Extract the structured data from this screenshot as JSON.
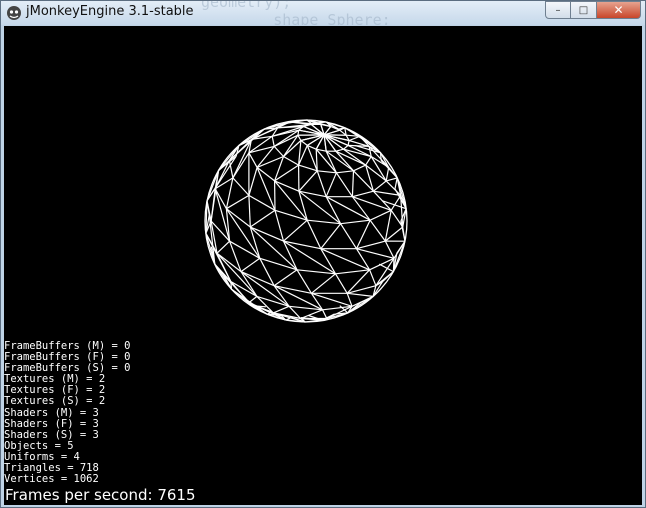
{
  "window": {
    "title": "jMonkeyEngine 3.1-stable",
    "behind_text": "geometry);\n        shape Sphere;",
    "controls": {
      "minimize": "–",
      "maximize": "□",
      "close": "✕"
    }
  },
  "stats": [
    {
      "label": "FrameBuffers (M)",
      "value": 0
    },
    {
      "label": "FrameBuffers (F)",
      "value": 0
    },
    {
      "label": "FrameBuffers (S)",
      "value": 0
    },
    {
      "label": "Textures (M)",
      "value": 2
    },
    {
      "label": "Textures (F)",
      "value": 2
    },
    {
      "label": "Textures (S)",
      "value": 2
    },
    {
      "label": "Shaders (M)",
      "value": 3
    },
    {
      "label": "Shaders (F)",
      "value": 3
    },
    {
      "label": "Shaders (S)",
      "value": 3
    },
    {
      "label": "Objects",
      "value": 5
    },
    {
      "label": "Uniforms",
      "value": 4
    },
    {
      "label": "Triangles",
      "value": 718
    },
    {
      "label": "Vertices",
      "value": 1062
    }
  ],
  "fps_text": "Frames per second: 7615",
  "colors": {
    "background": "#000000",
    "wireframe": "#ffffff",
    "text": "#ffffff"
  },
  "icons": {
    "app": "jmonkey-app-icon",
    "minimize": "minimize-icon",
    "maximize": "maximize-icon",
    "close": "close-icon"
  }
}
